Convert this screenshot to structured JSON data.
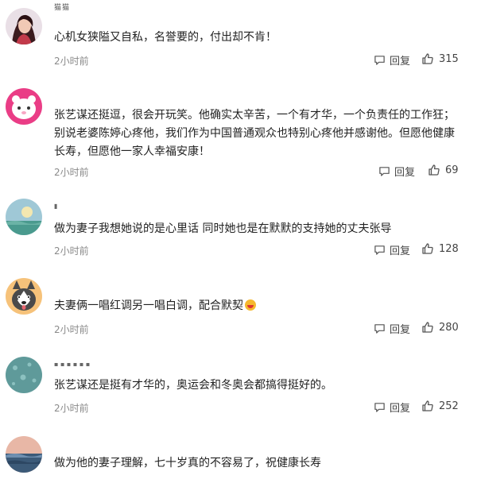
{
  "comments": [
    {
      "username": "猫猫",
      "text": "心机女狭隘又自私，名誉要的，付出却不肯！",
      "time": "2小时前",
      "reply_label": "回复",
      "likes": "315",
      "avatar_icon": "woman-portrait-avatar"
    },
    {
      "username": "",
      "text": "张艺谋还挺逗，很会开玩笑。他确实太辛苦，一个有才华，一个负责任的工作狂；别说老婆陈婷心疼他，我们作为中国普通观众也特别心疼他并感谢他。但愿他健康长寿，但愿他一家人幸福安康！",
      "time": "2小时前",
      "reply_label": "回复",
      "likes": "69",
      "avatar_icon": "pink-cartoon-avatar"
    },
    {
      "username": "",
      "text": "做为妻子我想她说的是心里话 同时她也是在默默的支持她的丈夫张导",
      "time": "2小时前",
      "reply_label": "回复",
      "likes": "128",
      "avatar_icon": "landscape-avatar"
    },
    {
      "username": "",
      "text": "夫妻俩一唱红调另一唱白调，配合默契",
      "time": "2小时前",
      "reply_label": "回复",
      "likes": "280",
      "avatar_icon": "husky-dog-avatar"
    },
    {
      "username": "",
      "text": "张艺谋还是挺有才华的，奥运会和冬奥会都搞得挺好的。",
      "time": "2小时前",
      "reply_label": "回复",
      "likes": "252",
      "avatar_icon": "raindrop-avatar"
    },
    {
      "username": "",
      "text": "做为他的妻子理解，七十岁真的不容易了，祝健康长寿",
      "avatar_icon": "sunset-sea-avatar"
    }
  ],
  "colors": {
    "text": "#222222",
    "meta": "#8a8a8a",
    "action": "#444444"
  }
}
